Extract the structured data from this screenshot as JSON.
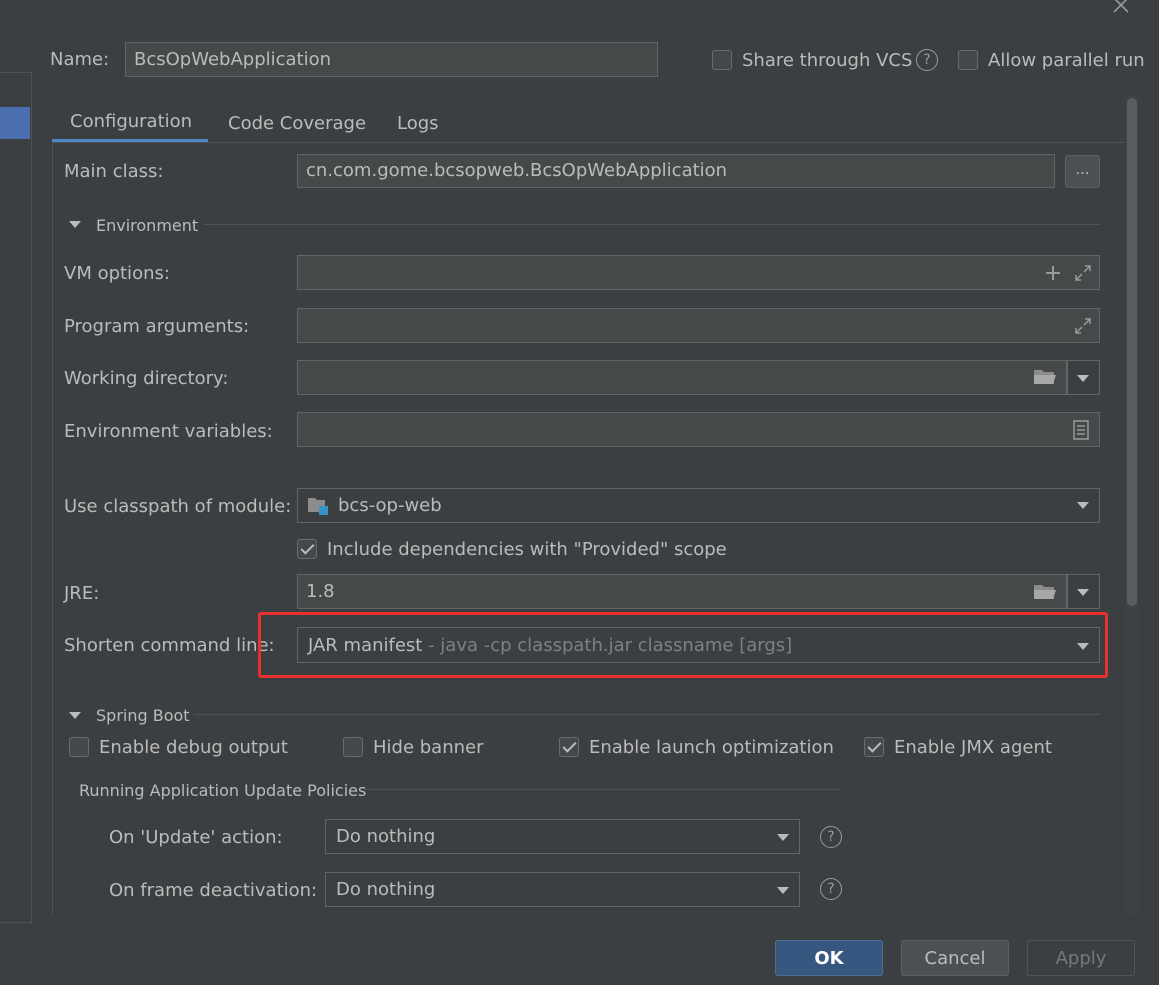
{
  "header": {
    "name_label": "Name:",
    "name_value": "BcsOpWebApplication",
    "share_vcs_label": "Share through VCS",
    "share_vcs_checked": false,
    "allow_parallel_label": "Allow parallel run",
    "allow_parallel_checked": false
  },
  "tabs": [
    {
      "label": "Configuration",
      "active": true
    },
    {
      "label": "Code Coverage",
      "active": false
    },
    {
      "label": "Logs",
      "active": false
    }
  ],
  "config": {
    "main_class_label": "Main class:",
    "main_class_value": "cn.com.gome.bcsopweb.BcsOpWebApplication",
    "browse_label": "...",
    "environment_section": "Environment",
    "vm_options_label": "VM options:",
    "vm_options_value": "",
    "program_args_label": "Program arguments:",
    "program_args_value": "",
    "working_dir_label": "Working directory:",
    "working_dir_value": "",
    "env_vars_label": "Environment variables:",
    "env_vars_value": "",
    "classpath_label": "Use classpath of module:",
    "classpath_value": "bcs-op-web",
    "include_deps_label": "Include dependencies with \"Provided\" scope",
    "include_deps_checked": true,
    "jre_label": "JRE:",
    "jre_value": "1.8",
    "shorten_label": "Shorten command line:",
    "shorten_value": "JAR manifest",
    "shorten_hint": " - java -cp classpath.jar classname [args]"
  },
  "spring_boot": {
    "section": "Spring Boot",
    "debug_label": "Enable debug output",
    "debug_checked": false,
    "hide_banner_label": "Hide banner",
    "hide_banner_checked": false,
    "launch_opt_label": "Enable launch optimization",
    "launch_opt_checked": true,
    "jmx_label": "Enable JMX agent",
    "jmx_checked": true,
    "policies_section": "Running Application Update Policies",
    "on_update_label": "On 'Update' action:",
    "on_update_value": "Do nothing",
    "on_frame_label": "On frame deactivation:",
    "on_frame_value": "Do nothing"
  },
  "footer": {
    "ok_label": "OK",
    "cancel_label": "Cancel",
    "apply_label": "Apply"
  },
  "colors": {
    "background": "#3c3f41",
    "highlight": "#e8312f",
    "accent": "#4a88c7",
    "primary_button": "#365880"
  }
}
